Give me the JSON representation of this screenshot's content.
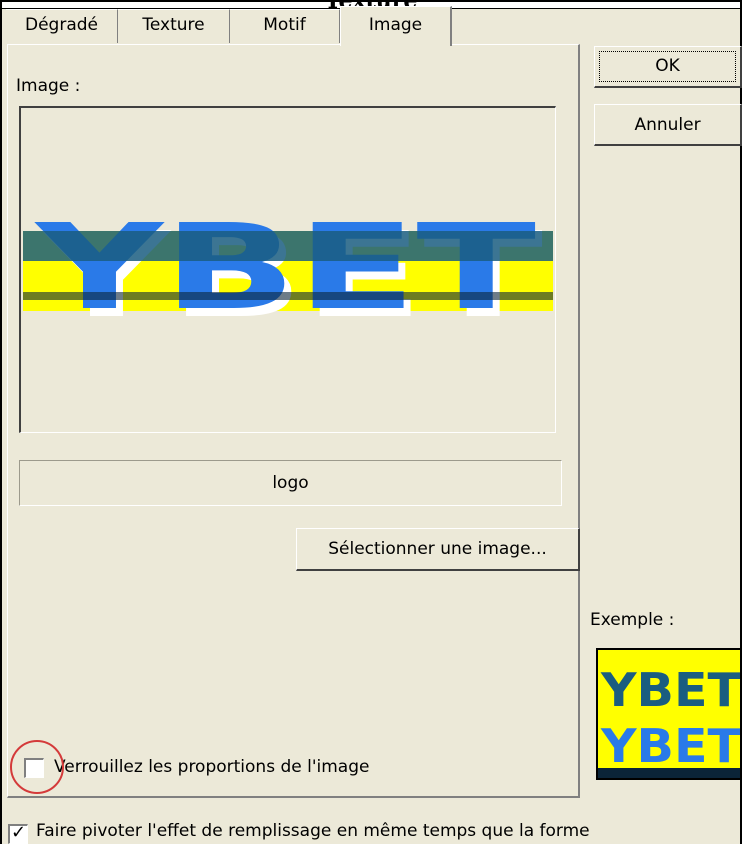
{
  "window": {
    "title": "Texture"
  },
  "tabs": [
    {
      "label": "Dégradé",
      "active": false
    },
    {
      "label": "Texture",
      "active": false
    },
    {
      "label": "Motif",
      "active": false
    },
    {
      "label": "Image",
      "active": true
    }
  ],
  "image_panel": {
    "image_label": "Image :",
    "preview_text": "YBET",
    "file_name": "logo",
    "select_button": "Sélectionner une image...",
    "lock_checkbox": {
      "label": "Verrouillez les proportions de l'image",
      "checked": false
    }
  },
  "buttons": {
    "ok": "OK",
    "cancel": "Annuler"
  },
  "sample": {
    "label": "Exemple :",
    "text": "YBET"
  },
  "rotate_checkbox": {
    "label": "Faire pivoter l'effet de remplissage en même temps que la forme",
    "checked": true
  },
  "colors": {
    "logo_yellow": "#ffff00",
    "logo_dark_blue": "#1a5d80",
    "logo_blue": "#2a7ae8",
    "annotation_red": "#d43a3a"
  }
}
